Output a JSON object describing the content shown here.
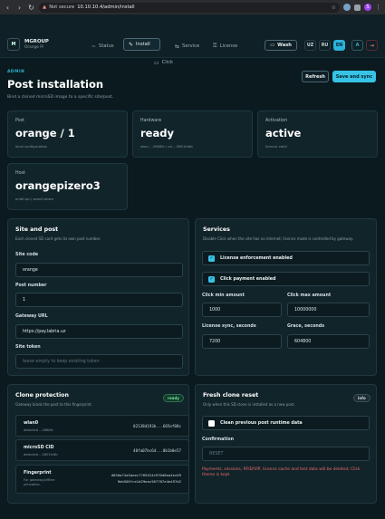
{
  "browser": {
    "not_secure": "Not secure",
    "url": "10.10.10.4/admin/install",
    "profile_initial": "S"
  },
  "header": {
    "logo_text": "M",
    "brand_name": "MGROUP",
    "brand_sub": "Orange Pi",
    "tabs": [
      {
        "label": "Status",
        "icon": "~"
      },
      {
        "label": "Install",
        "icon": "✎"
      },
      {
        "label": "Service",
        "icon": "⇆"
      },
      {
        "label": "License",
        "icon": "⚿"
      },
      {
        "label": "Click",
        "icon": "▭"
      }
    ],
    "wash_label": "Wash",
    "languages": [
      "UZ",
      "RU",
      "EN"
    ],
    "active_language": "EN",
    "a_label": "A"
  },
  "page": {
    "eyebrow": "ADMIN",
    "title": "Post installation",
    "subtitle": "Bind a cloned microSD image to a specific site/post.",
    "refresh_label": "Refresh",
    "save_label": "Save and sync"
  },
  "stats": [
    {
      "label": "Post",
      "value": "orange / 1",
      "sub": "local configuration"
    },
    {
      "label": "Hardware",
      "value": "ready",
      "sub": "wlan ...2668fc / sd ...5601fc6b"
    },
    {
      "label": "Activation",
      "value": "active",
      "sub": "licence valid"
    },
    {
      "label": "Host",
      "value": "orangepizero3",
      "sub": "end0:up / wlan0:down"
    }
  ],
  "site_post": {
    "title": "Site and post",
    "desc": "Each cloned SD card gets its own post number.",
    "site_code_label": "Site code",
    "site_code_value": "orange",
    "post_number_label": "Post number",
    "post_number_value": "1",
    "gateway_url_label": "Gateway URL",
    "gateway_url_value": "https://pay.labria.uz",
    "site_token_label": "Site token",
    "site_token_placeholder": "leave empty to keep existing token"
  },
  "services": {
    "title": "Services",
    "desc": "Disable Click when the site has no internet; licence mode is controlled by gateway.",
    "license_enforcement_label": "License enforcement enabled",
    "click_payment_label": "Click payment enabled",
    "click_min_label": "Click min amount",
    "click_min_value": "1000",
    "click_max_label": "Click max amount",
    "click_max_value": "10000000",
    "license_sync_label": "License sync, seconds",
    "license_sync_value": "7200",
    "grace_label": "Grace, seconds",
    "grace_value": "604800"
  },
  "clone_protection": {
    "title": "Clone protection",
    "desc": "Gateway binds the post to this fingerprint.",
    "badge": "ready",
    "rows": [
      {
        "name": "wlan0",
        "sub": "detected ...2668fc",
        "value": "02138d193b...665ef08c"
      },
      {
        "name": "microSD CID",
        "sub": "detected ...5601fc6b",
        "value": "40fa07bc64...0b1b0e57"
      },
      {
        "name": "Fingerprint",
        "sub": "For gateway/offline activation.",
        "value1": "d050a74a3aeec7769424c970d8ea4ec69",
        "value2": "9eb505fce1d29eac567707e4e497d2"
      }
    ]
  },
  "fresh_reset": {
    "title": "Fresh clone reset",
    "desc": "Only when this SD clone is installed as a new post.",
    "badge": "info",
    "clean_label": "Clean previous post runtime data",
    "confirmation_label": "Confirmation",
    "confirmation_placeholder": "RESET",
    "warning": "Payments, sessions, RFID/VIP, licence cache and test data will be deleted; Click theme is kept."
  }
}
